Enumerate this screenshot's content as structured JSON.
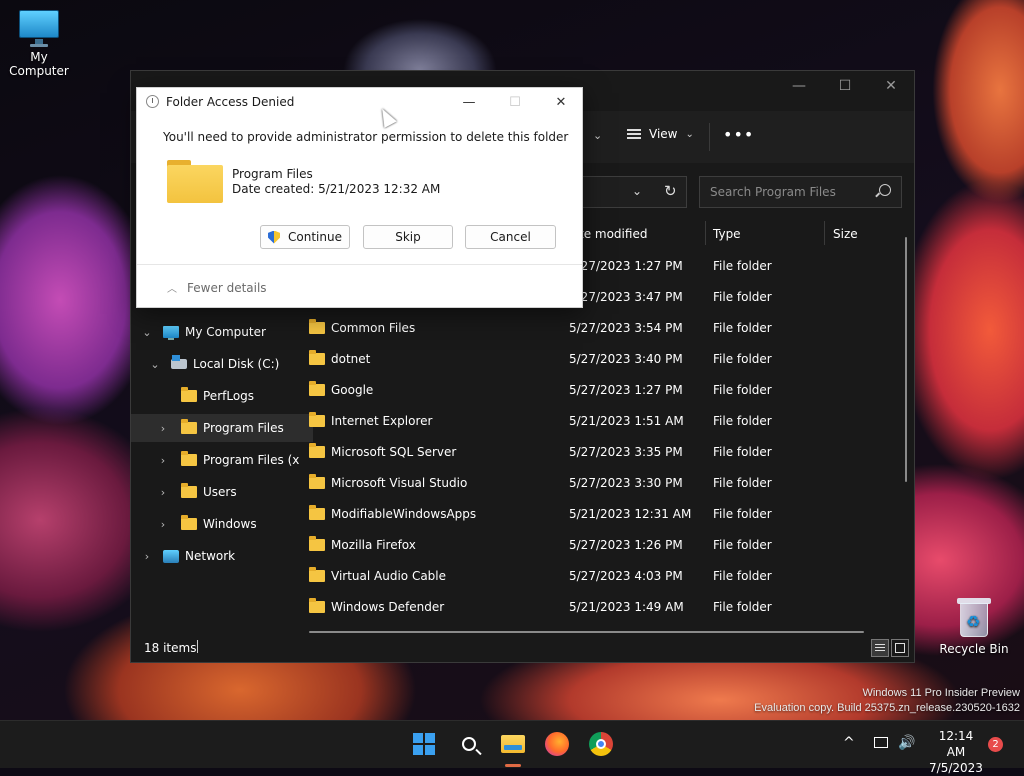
{
  "desktop": {
    "icons": [
      {
        "label": "My Computer",
        "icon": "computer-icon"
      },
      {
        "label": "Recycle Bin",
        "icon": "recycle-bin-icon"
      }
    ],
    "watermark": {
      "line1": "Windows 11 Pro Insider Preview",
      "line2": "Evaluation copy. Build 25375.zn_release.230520-1632"
    }
  },
  "explorer": {
    "window_controls": {
      "minimize": "—",
      "maximize": "☐",
      "close": "✕"
    },
    "toolbar": {
      "view_label": "View",
      "more_label": "•••"
    },
    "search_placeholder": "Search Program Files",
    "columns": {
      "date": "Date modified",
      "date_visible": "te modified",
      "type": "Type",
      "size": "Size"
    },
    "nav_items": [
      {
        "label": "My Computer",
        "icon": "computer-icon",
        "expanded": true
      },
      {
        "label": "Local Disk (C:)",
        "icon": "disk-icon",
        "expanded": true
      },
      {
        "label": "PerfLogs",
        "icon": "folder-icon"
      },
      {
        "label": "Program Files",
        "icon": "folder-icon",
        "selected": true
      },
      {
        "label": "Program Files (x",
        "icon": "folder-icon"
      },
      {
        "label": "Users",
        "icon": "folder-icon"
      },
      {
        "label": "Windows",
        "icon": "folder-icon"
      },
      {
        "label": "Network",
        "icon": "network-icon"
      }
    ],
    "files": [
      {
        "name": "",
        "date": "5/27/2023 1:27 PM",
        "type": "File folder"
      },
      {
        "name": "",
        "date": "5/27/2023 3:47 PM",
        "type": "File folder"
      },
      {
        "name": "Common Files",
        "date": "5/27/2023 3:54 PM",
        "type": "File folder"
      },
      {
        "name": "dotnet",
        "date": "5/27/2023 3:40 PM",
        "type": "File folder"
      },
      {
        "name": "Google",
        "date": "5/27/2023 1:27 PM",
        "type": "File folder"
      },
      {
        "name": "Internet Explorer",
        "date": "5/21/2023 1:51 AM",
        "type": "File folder"
      },
      {
        "name": "Microsoft SQL Server",
        "date": "5/27/2023 3:35 PM",
        "type": "File folder"
      },
      {
        "name": "Microsoft Visual Studio",
        "date": "5/27/2023 3:30 PM",
        "type": "File folder"
      },
      {
        "name": "ModifiableWindowsApps",
        "date": "5/21/2023 12:31 AM",
        "type": "File folder"
      },
      {
        "name": "Mozilla Firefox",
        "date": "5/27/2023 1:26 PM",
        "type": "File folder"
      },
      {
        "name": "Virtual Audio Cable",
        "date": "5/27/2023 4:03 PM",
        "type": "File folder"
      },
      {
        "name": "Windows Defender",
        "date": "5/21/2023 1:49 AM",
        "type": "File folder"
      }
    ],
    "status": {
      "item_count": "18 items"
    }
  },
  "dialog": {
    "title": "Folder Access Denied",
    "message": "You'll need to provide administrator permission to delete this folder",
    "folder_name": "Program Files",
    "date_created": "Date created: 5/21/2023 12:32 AM",
    "buttons": {
      "continue": "Continue",
      "skip": "Skip",
      "cancel": "Cancel"
    },
    "fewer_details": "Fewer details",
    "controls": {
      "minimize": "—",
      "maximize": "☐",
      "close": "✕"
    }
  },
  "taskbar": {
    "apps": [
      "start-icon",
      "search-icon",
      "file-explorer-icon",
      "firefox-icon",
      "chrome-icon"
    ],
    "tray": {
      "chevron": "^",
      "volume": "🔊"
    },
    "time": "12:14 AM",
    "date": "7/5/2023",
    "notification_count": "2"
  }
}
